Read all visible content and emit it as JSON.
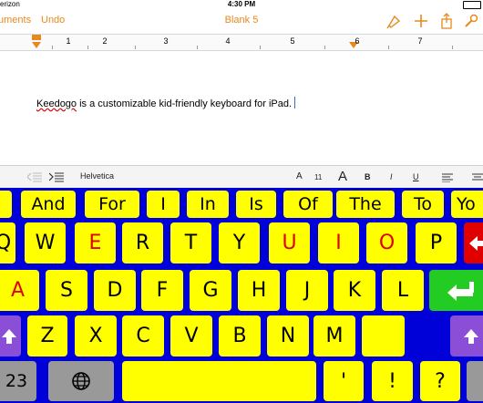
{
  "status_bar": {
    "carrier": "erizon",
    "time": "4:30 PM"
  },
  "nav": {
    "back_label": "uments",
    "undo_label": "Undo",
    "title": "Blank 5",
    "icons": [
      "brush-icon",
      "plus-icon",
      "share-icon",
      "wrench-icon"
    ]
  },
  "ruler": {
    "numbers": [
      "1",
      "2",
      "3",
      "4",
      "5",
      "6",
      "7"
    ]
  },
  "document": {
    "first_word": "Keedogo",
    "rest": " is a customizable kid-friendly keyboard for iPad."
  },
  "format_bar": {
    "font_name": "Helvetica",
    "font_size": "11",
    "size_small_label": "A",
    "size_large_label": "A",
    "bold_label": "B",
    "italic_label": "I",
    "underline_label": "U"
  },
  "keyboard": {
    "colors": {
      "background": "#0000d8",
      "key": "#ffff00",
      "vowel_text": "#e00000",
      "modifier_key": "#999999",
      "enter": "#22cc22",
      "delete": "#e00000",
      "shift": "#8a4fd6"
    },
    "word_row": [
      "And",
      "For",
      "I",
      "In",
      "Is",
      "Of",
      "The",
      "To",
      "Yo"
    ],
    "row1": [
      "Q",
      "W",
      "E",
      "R",
      "T",
      "Y",
      "U",
      "I",
      "O",
      "P"
    ],
    "row2": [
      "A",
      "S",
      "D",
      "F",
      "G",
      "H",
      "J",
      "K",
      "L"
    ],
    "row3": [
      "Z",
      "X",
      "C",
      "V",
      "B",
      "N",
      "M"
    ],
    "row4": {
      "numbers_label": "23",
      "apostrophe": "'",
      "exclaim": "!",
      "question": "?"
    },
    "vowels": [
      "E",
      "U",
      "I",
      "O",
      "A"
    ]
  }
}
